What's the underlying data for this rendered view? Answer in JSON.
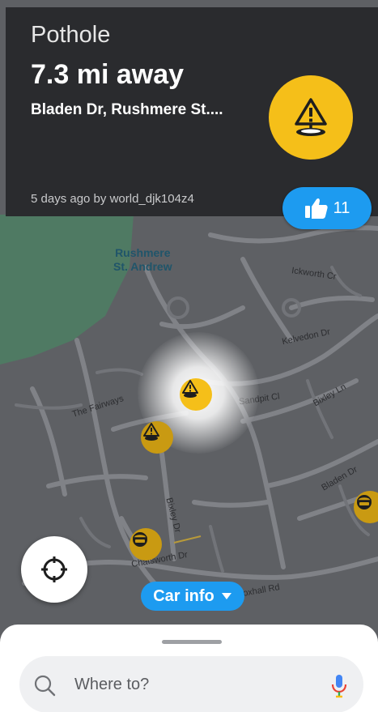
{
  "alert": {
    "type": "Pothole",
    "distance": "7.3 mi away",
    "street": "Bladen Dr, Rushmere St....",
    "reported": "5 days ago by world_djk104z4",
    "thumbs_count": "11",
    "icon": "pothole-warning-icon"
  },
  "map": {
    "area_label_line1": "Rushmere",
    "area_label_line2": "St. Andrew",
    "streets": {
      "ickworth": "Ickworth Cr",
      "kelvedon": "Kelvedon Dr",
      "fairways": "The Fairways",
      "sandpit": "Sandpit Cl",
      "bixley_ln": "Bixley Ln",
      "bladen": "Bladen Dr",
      "bixley_dr": "Bixley Dr",
      "chatsworth": "Chatsworth Dr",
      "foxhall": "oxhall Rd"
    },
    "colors": {
      "background": "#5e6064",
      "roads": "#808287",
      "park": "#4f7a63"
    }
  },
  "controls": {
    "car_info_label": "Car info",
    "recenter_icon": "crosshair-icon"
  },
  "search": {
    "placeholder": "Where to?",
    "value": ""
  },
  "theme": {
    "accent": "#1d9bf0",
    "warning": "#f5bf19",
    "header_bg": "#2a2b2e"
  }
}
